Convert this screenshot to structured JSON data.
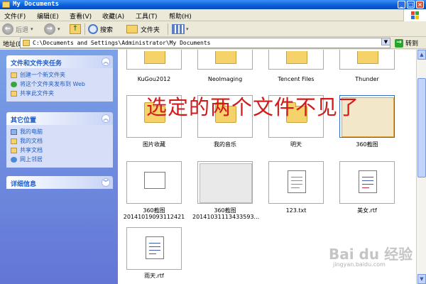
{
  "window": {
    "title": "My Documents"
  },
  "menu": [
    "文件(F)",
    "编辑(E)",
    "查看(V)",
    "收藏(A)",
    "工具(T)",
    "帮助(H)"
  ],
  "toolbar": {
    "back": "后退",
    "search": "搜索",
    "folders": "文件夹"
  },
  "address": {
    "label": "地址(D)",
    "path": "C:\\Documents and Settings\\Administrator\\My Documents",
    "go": "转到"
  },
  "left": {
    "tasks": {
      "title": "文件和文件夹任务",
      "items": [
        "创建一个新文件夹",
        "将这个文件夹发布到 Web",
        "共享此文件夹"
      ]
    },
    "places": {
      "title": "其它位置",
      "items": [
        "我的电脑",
        "我的文档",
        "共享文档",
        "网上邻居"
      ]
    },
    "details": {
      "title": "详细信息"
    }
  },
  "files": {
    "row1": [
      "KuGou2012",
      "NeoImaging",
      "Tencent Files",
      "Thunder"
    ],
    "row2": [
      "图片收藏",
      "我的音乐",
      "明天",
      "360截图"
    ],
    "row3": [
      {
        "l1": "360截图",
        "l2": "20141019093112421"
      },
      {
        "l1": "360截图",
        "l2": "20141031113433593..."
      },
      {
        "l1": "123.txt",
        "l2": ""
      },
      {
        "l1": "美女.rtf",
        "l2": ""
      }
    ],
    "row4": [
      "雨天.rtf"
    ]
  },
  "overlay": "选定的两个文件不见了",
  "watermark": {
    "brand": "Bai du 经验",
    "url": "jingyan.baidu.com"
  }
}
